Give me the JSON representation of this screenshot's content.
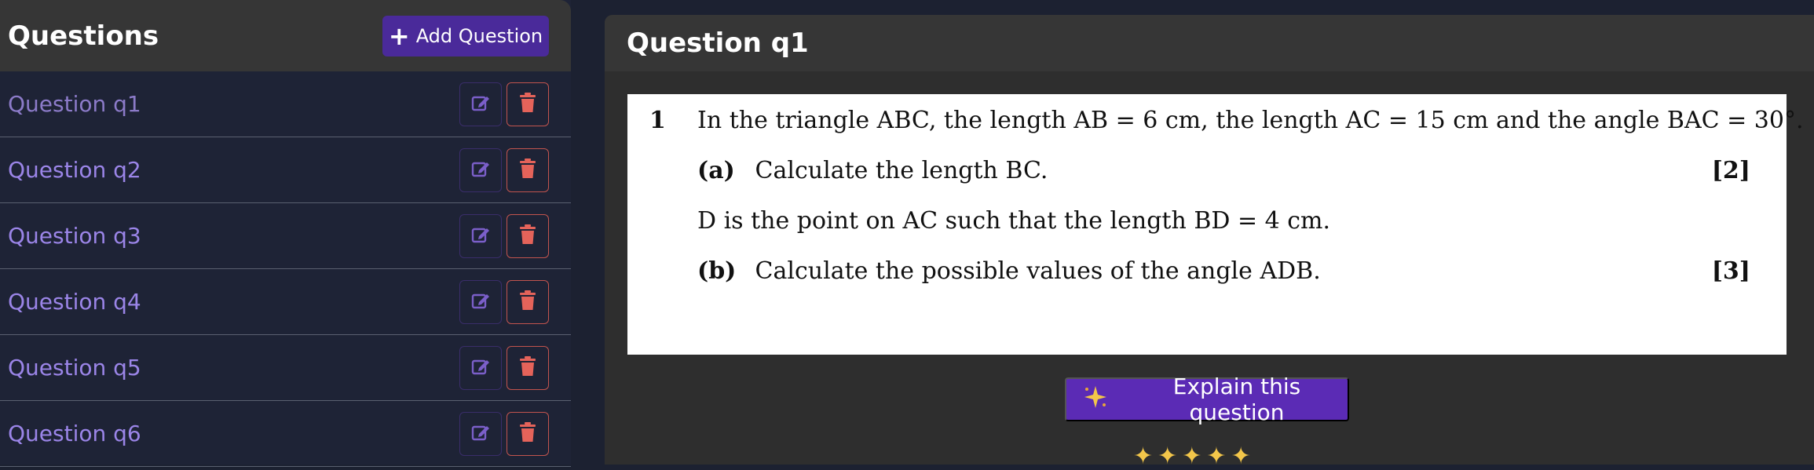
{
  "sidebar": {
    "title": "Questions",
    "add_button": {
      "icon": "plus-icon",
      "label": "Add Question"
    },
    "items": [
      {
        "label": "Question q1",
        "edit_icon": "edit-icon",
        "delete_icon": "trash-icon"
      },
      {
        "label": "Question q2",
        "edit_icon": "edit-icon",
        "delete_icon": "trash-icon"
      },
      {
        "label": "Question q3",
        "edit_icon": "edit-icon",
        "delete_icon": "trash-icon"
      },
      {
        "label": "Question q4",
        "edit_icon": "edit-icon",
        "delete_icon": "trash-icon"
      },
      {
        "label": "Question q5",
        "edit_icon": "edit-icon",
        "delete_icon": "trash-icon"
      },
      {
        "label": "Question q6",
        "edit_icon": "edit-icon",
        "delete_icon": "trash-icon"
      }
    ]
  },
  "main": {
    "title": "Question q1",
    "question": {
      "number": "1",
      "stem": "In the triangle ABC, the length AB = 6 cm, the length AC = 15 cm and the angle BAC = 30°.",
      "part_a": {
        "label": "(a)",
        "text": "Calculate the length BC.",
        "marks": "[2]"
      },
      "context": "D is the point on AC such that the length BD = 4 cm.",
      "part_b": {
        "label": "(b)",
        "text": "Calculate the possible values of the angle ADB.",
        "marks": "[3]"
      }
    },
    "explain_button": {
      "icon": "sparkle-icon",
      "label": "Explain this question"
    },
    "stars_icon": "sparkle-star-icon"
  },
  "colors": {
    "accent": "#4a2a9a",
    "explain": "#5b2bb5",
    "link": "#9b85e8",
    "delete": "#e5635a",
    "background": "#1c2131",
    "panel": "#363636"
  }
}
